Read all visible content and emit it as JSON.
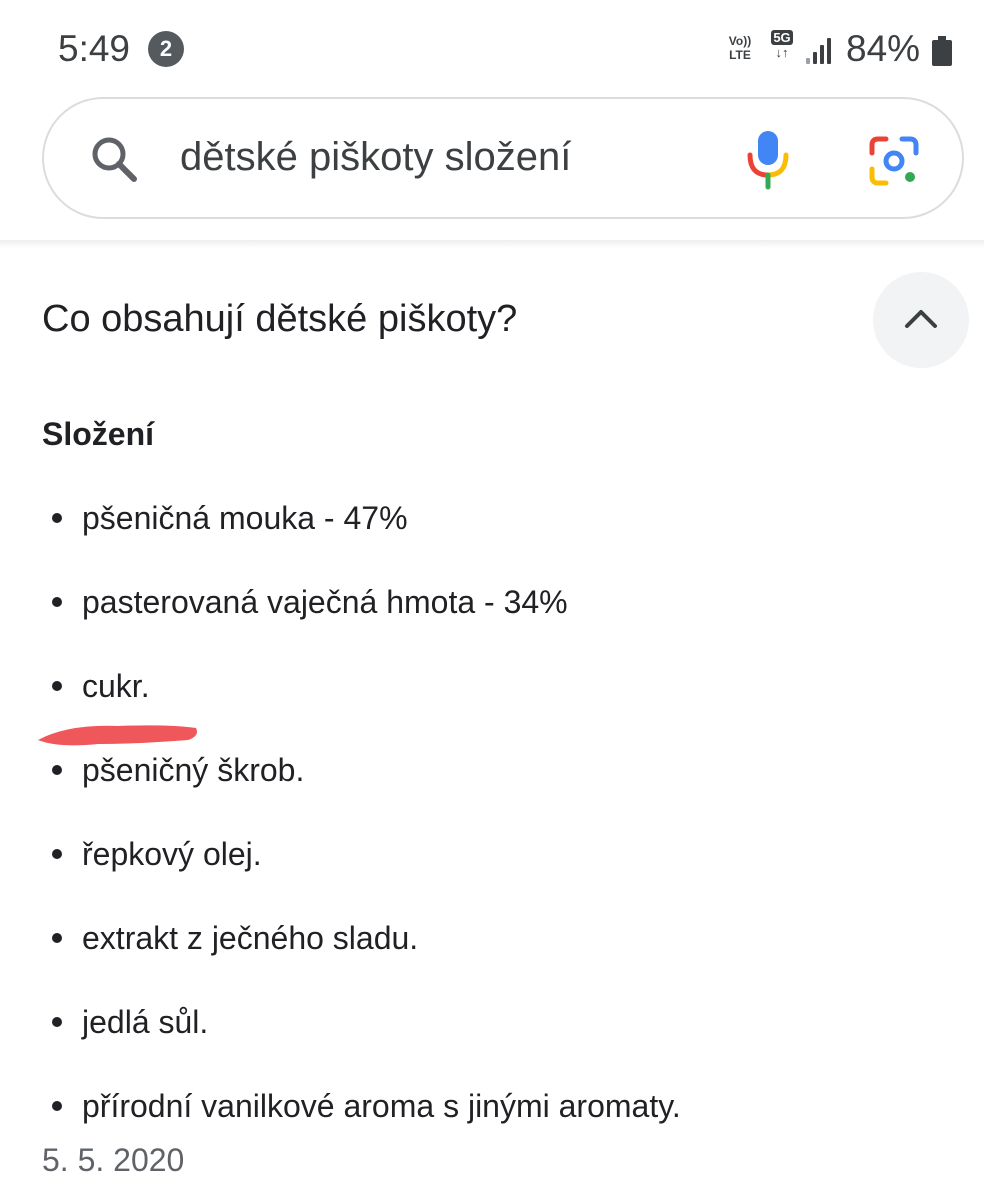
{
  "status_bar": {
    "time": "5:49",
    "notification_count": "2",
    "volte_label_top": "Vo))",
    "volte_label_bottom": "LTE",
    "network_label": "5G",
    "network_arrows": "↓↑",
    "battery_percent": "84%"
  },
  "search": {
    "query": "dětské piškoty složení",
    "icons": [
      "search-icon",
      "microphone-icon",
      "google-lens-icon"
    ]
  },
  "answer": {
    "question": "Co obsahují dětské piškoty?",
    "section_heading": "Složení",
    "ingredients": [
      "pšeničná mouka - 47%",
      "pasterovaná vaječná hmota - 34%",
      "cukr.",
      "pšeničný škrob.",
      "řepkový olej.",
      "extrakt z ječného sladu.",
      "jedlá sůl.",
      "přírodní vanilkové aroma s jinými aromaty."
    ],
    "date": "5. 5. 2020"
  },
  "colors": {
    "google_blue": "#4285F4",
    "google_red": "#EA4335",
    "google_yellow": "#FBBC04",
    "google_green": "#34A853",
    "highlight_mark": "#F0575A"
  }
}
